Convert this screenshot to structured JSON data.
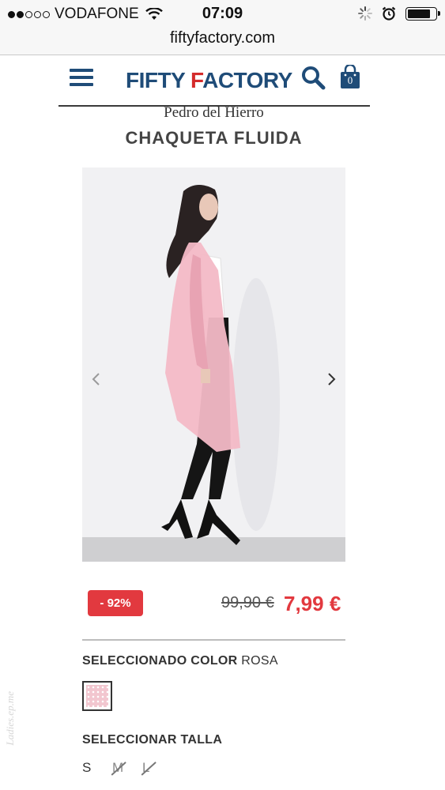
{
  "status_bar": {
    "carrier": "VODAFONE",
    "time": "07:09",
    "signal_dots_filled": 2,
    "signal_dots_total": 5,
    "battery_percent": 82,
    "icons": [
      "wifi-icon",
      "activity-spinner-icon",
      "alarm-icon",
      "battery-icon"
    ]
  },
  "browser": {
    "url": "fiftyfactory.com"
  },
  "header": {
    "logo_part1": "FIFTY ",
    "logo_f": "F",
    "logo_part2": "ACTORY",
    "cart_count": "0",
    "brand_colors": {
      "navy": "#1f4c78",
      "red": "#d42b2b"
    }
  },
  "product": {
    "brand": "Pedro del Hierro",
    "title": "CHAQUETA FLUIDA",
    "discount": "- 92%",
    "old_price": "99,90 €",
    "new_price": "7,99 €",
    "accent_color": "#e2393f"
  },
  "color_section": {
    "label": "SELECCIONADO COLOR",
    "value": "ROSA",
    "swatch_color": "#f2c6cf"
  },
  "size_section": {
    "label": "SELECCIONAR TALLA",
    "sizes": [
      {
        "label": "S",
        "available": true
      },
      {
        "label": "M",
        "available": false
      },
      {
        "label": "L",
        "available": false
      }
    ]
  },
  "watermark": "Ladies.ep.me"
}
